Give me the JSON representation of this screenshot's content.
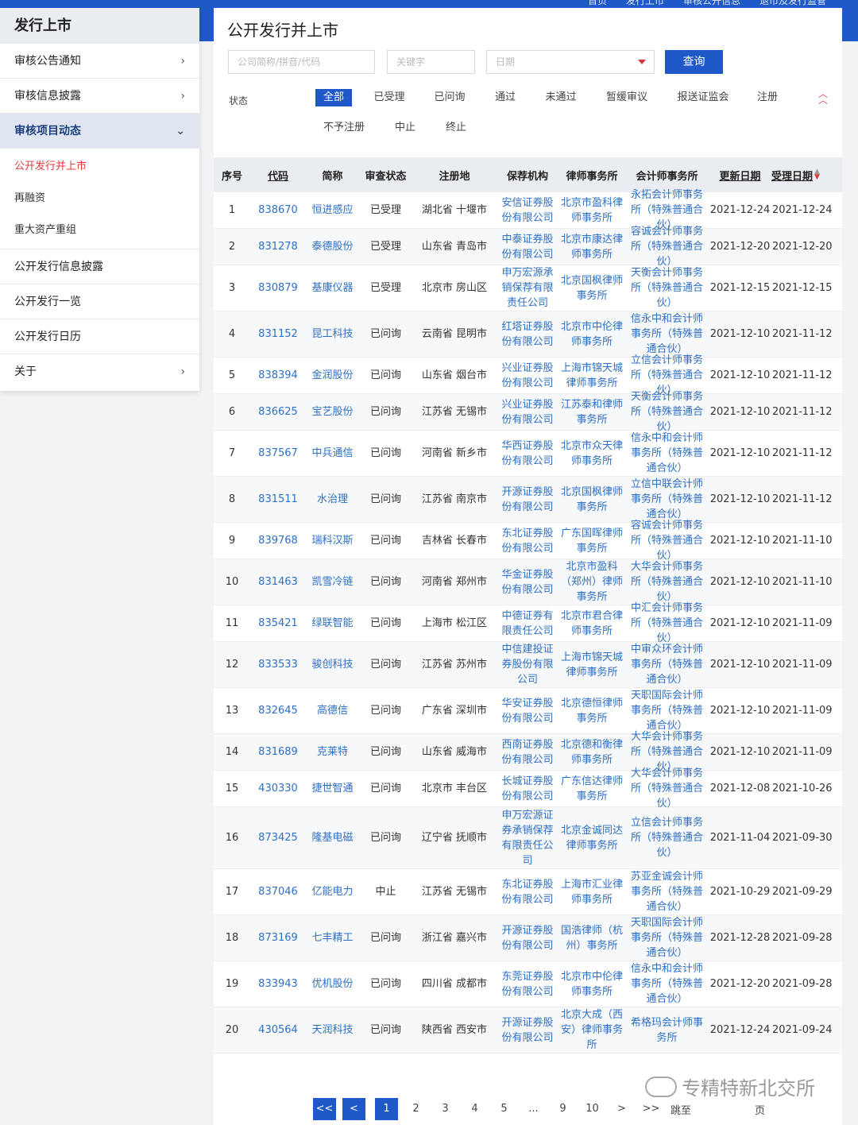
{
  "topnav": [
    "首页",
    "发行上市",
    "审核公开信息",
    "退市及发行监管"
  ],
  "sidebar": {
    "title": "发行上市",
    "items": [
      {
        "label": "审核公告通知",
        "chevron": "›"
      },
      {
        "label": "审核信息披露",
        "chevron": "›"
      },
      {
        "label": "审核项目动态",
        "chevron": "⌄",
        "active": true
      },
      {
        "label": "公开发行信息披露"
      },
      {
        "label": "公开发行一览"
      },
      {
        "label": "公开发行日历"
      },
      {
        "label": "关于",
        "chevron": "›"
      }
    ],
    "subitems": [
      "公开发行并上市",
      "再融资",
      "重大资产重组"
    ]
  },
  "main": {
    "title": "公开发行并上市",
    "filters": {
      "company_placeholder": "公司简称/拼音/代码",
      "keyword_placeholder": "关键字",
      "date_placeholder": "日期",
      "query_label": "查询"
    },
    "status_label": "状态",
    "statuses": [
      "全部",
      "已受理",
      "已问询",
      "通过",
      "未通过",
      "暂缓审议",
      "报送证监会",
      "注册",
      "不予注册",
      "中止",
      "终止"
    ],
    "selected_status": "全部"
  },
  "table": {
    "headers": [
      "序号",
      "代码",
      "简称",
      "审查状态",
      "注册地",
      "保荐机构",
      "律师事务所",
      "会计师事务所",
      "更新日期",
      "受理日期"
    ],
    "rows": [
      [
        "1",
        "838670",
        "恒进感应",
        "已受理",
        "湖北省 十堰市",
        "安信证券股份有限公司",
        "北京市盈科律师事务所",
        "永拓会计师事务所（特殊普通合伙）",
        "2021-12-24",
        "2021-12-24"
      ],
      [
        "2",
        "831278",
        "泰德股份",
        "已受理",
        "山东省 青岛市",
        "中泰证券股份有限公司",
        "北京市康达律师事务所",
        "容诚会计师事务所（特殊普通合伙）",
        "2021-12-20",
        "2021-12-20"
      ],
      [
        "3",
        "830879",
        "基康仪器",
        "已受理",
        "北京市 房山区",
        "申万宏源承销保荐有限责任公司",
        "北京国枫律师事务所",
        "天衡会计师事务所（特殊普通合伙）",
        "2021-12-15",
        "2021-12-15"
      ],
      [
        "4",
        "831152",
        "昆工科技",
        "已问询",
        "云南省 昆明市",
        "红塔证券股份有限公司",
        "北京市中伦律师事务所",
        "信永中和会计师事务所（特殊普通合伙）",
        "2021-12-10",
        "2021-11-12"
      ],
      [
        "5",
        "838394",
        "金润股份",
        "已问询",
        "山东省 烟台市",
        "兴业证券股份有限公司",
        "上海市锦天城律师事务所",
        "立信会计师事务所（特殊普通合伙）",
        "2021-12-10",
        "2021-11-12"
      ],
      [
        "6",
        "836625",
        "宝艺股份",
        "已问询",
        "江苏省 无锡市",
        "兴业证券股份有限公司",
        "江苏泰和律师事务所",
        "天衡会计师事务所（特殊普通合伙）",
        "2021-12-10",
        "2021-11-12"
      ],
      [
        "7",
        "837567",
        "中兵通信",
        "已问询",
        "河南省 新乡市",
        "华西证券股份有限公司",
        "北京市众天律师事务所",
        "信永中和会计师事务所（特殊普通合伙）",
        "2021-12-10",
        "2021-11-12"
      ],
      [
        "8",
        "831511",
        "水治理",
        "已问询",
        "江苏省 南京市",
        "开源证券股份有限公司",
        "北京国枫律师事务所",
        "立信中联会计师事务所（特殊普通合伙）",
        "2021-12-10",
        "2021-11-12"
      ],
      [
        "9",
        "839768",
        "瑞科汉斯",
        "已问询",
        "吉林省 长春市",
        "东北证券股份有限公司",
        "广东国晖律师事务所",
        "容诚会计师事务所（特殊普通合伙）",
        "2021-12-10",
        "2021-11-10"
      ],
      [
        "10",
        "831463",
        "凯雪冷链",
        "已问询",
        "河南省 郑州市",
        "华金证券股份有限公司",
        "北京市盈科（郑州）律师事务所",
        "大华会计师事务所（特殊普通合伙）",
        "2021-12-10",
        "2021-11-10"
      ],
      [
        "11",
        "835421",
        "绿联智能",
        "已问询",
        "上海市 松江区",
        "中德证券有限责任公司",
        "北京市君合律师事务所",
        "中汇会计师事务所（特殊普通合伙）",
        "2021-12-10",
        "2021-11-09"
      ],
      [
        "12",
        "833533",
        "骏创科技",
        "已问询",
        "江苏省 苏州市",
        "中信建投证券股份有限公司",
        "上海市锦天城律师事务所",
        "中审众环会计师事务所（特殊普通合伙）",
        "2021-12-10",
        "2021-11-09"
      ],
      [
        "13",
        "832645",
        "高德信",
        "已问询",
        "广东省 深圳市",
        "华安证券股份有限公司",
        "北京德恒律师事务所",
        "天职国际会计师事务所（特殊普通合伙）",
        "2021-12-10",
        "2021-11-09"
      ],
      [
        "14",
        "831689",
        "克莱特",
        "已问询",
        "山东省 威海市",
        "西南证券股份有限公司",
        "北京德和衡律师事务所",
        "大华会计师事务所（特殊普通合伙）",
        "2021-12-10",
        "2021-11-09"
      ],
      [
        "15",
        "430330",
        "捷世智通",
        "已问询",
        "北京市 丰台区",
        "长城证券股份有限公司",
        "广东信达律师事务所",
        "大华会计师事务所（特殊普通合伙）",
        "2021-12-08",
        "2021-10-26"
      ],
      [
        "16",
        "873425",
        "隆基电磁",
        "已问询",
        "辽宁省 抚顺市",
        "申万宏源证券承销保荐有限责任公司",
        "北京金诚同达律师事务所",
        "立信会计师事务所（特殊普通合伙）",
        "2021-11-04",
        "2021-09-30"
      ],
      [
        "17",
        "837046",
        "亿能电力",
        "中止",
        "江苏省 无锡市",
        "东北证券股份有限公司",
        "上海市汇业律师事务所",
        "苏亚金诚会计师事务所（特殊普通合伙）",
        "2021-10-29",
        "2021-09-29"
      ],
      [
        "18",
        "873169",
        "七丰精工",
        "已问询",
        "浙江省 嘉兴市",
        "开源证券股份有限公司",
        "国浩律师（杭州）事务所",
        "天职国际会计师事务所（特殊普通合伙）",
        "2021-12-28",
        "2021-09-28"
      ],
      [
        "19",
        "833943",
        "优机股份",
        "已问询",
        "四川省 成都市",
        "东莞证券股份有限公司",
        "北京市中伦律师事务所",
        "信永中和会计师事务所（特殊普通合伙）",
        "2021-12-20",
        "2021-09-28"
      ],
      [
        "20",
        "430564",
        "天润科技",
        "已问询",
        "陕西省 西安市",
        "开源证券股份有限公司",
        "北京大成（西安）律师事务所",
        "希格玛会计师事务所",
        "2021-12-24",
        "2021-09-24"
      ]
    ]
  },
  "pager": {
    "first": "<<",
    "prev": "<",
    "pages": [
      "1",
      "2",
      "3",
      "4",
      "5",
      "...",
      "9",
      "10"
    ],
    "current": "1",
    "next": ">",
    "last": ">>",
    "goto_label": "跳至",
    "page_suffix": "页"
  },
  "watermark": "专精特新北交所"
}
